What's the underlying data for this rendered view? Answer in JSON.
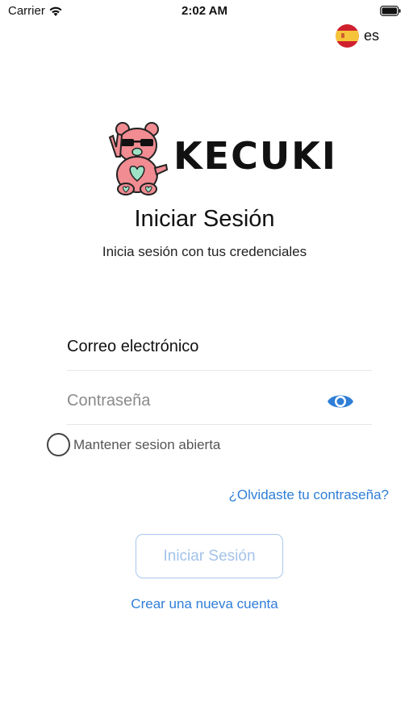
{
  "status_bar": {
    "carrier": "Carrier",
    "time": "2:02 AM"
  },
  "language": {
    "code": "es",
    "flag_icon": "spain-flag-icon"
  },
  "logo": {
    "wordmark": "KECUKI",
    "mascot_icon": "bear-mascot-icon"
  },
  "login": {
    "title": "Iniciar Sesión",
    "subtitle": "Inicia sesión con tus credenciales",
    "email_placeholder": "Correo electrónico",
    "password_placeholder": "Contraseña",
    "show_password_icon": "eye-icon",
    "keep_session_label": "Mantener sesion abierta",
    "forgot_password": "¿Olvidaste tu contraseña?",
    "submit_label": "Iniciar Sesión",
    "create_account": "Crear una nueva cuenta"
  },
  "colors": {
    "link": "#2f7ed8",
    "button_disabled_text": "#a3c2ea",
    "button_border": "#a9c8ee",
    "bear_pink": "#f08c92",
    "bear_mint": "#9fe3c7"
  }
}
